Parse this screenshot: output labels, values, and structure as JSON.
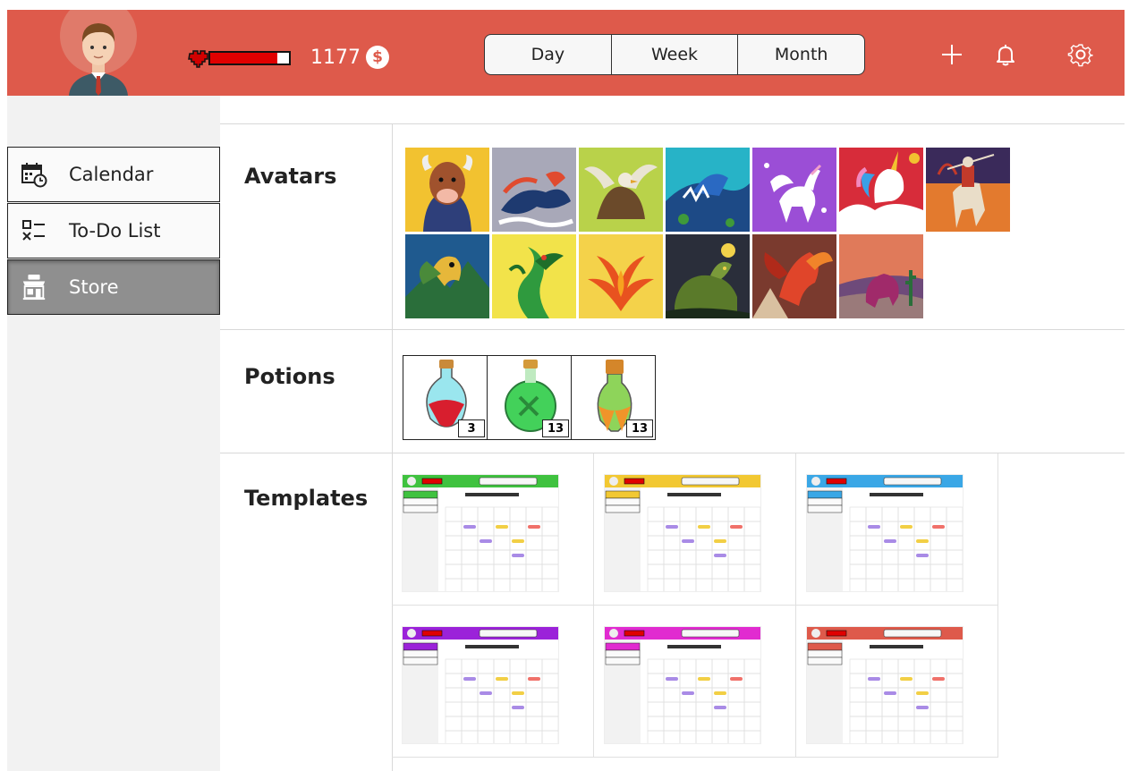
{
  "header": {
    "coins": "1177",
    "coin_symbol": "$",
    "health_fraction": 0.85,
    "views": [
      "Day",
      "Week",
      "Month"
    ],
    "icons": [
      "add-icon",
      "bell-icon",
      "gear-icon"
    ]
  },
  "colors": {
    "header": "#de5a4b",
    "health": "#e00000",
    "sidebar": "#f2f2f2",
    "active_nav": "#8f8f8f"
  },
  "sidebar": {
    "items": [
      {
        "label": "Calendar",
        "icon": "calendar-clock-icon"
      },
      {
        "label": "To-Do List",
        "icon": "checklist-icon"
      },
      {
        "label": "Store",
        "icon": "store-icon"
      }
    ],
    "active": "Store"
  },
  "sections": {
    "avatars": "Avatars",
    "potions": "Potions",
    "templates": "Templates"
  },
  "avatars": [
    {
      "icon": "bull-avatar-icon"
    },
    {
      "icon": "kirin-avatar-icon"
    },
    {
      "icon": "griffin-avatar-icon"
    },
    {
      "icon": "sea-serpent-avatar-icon"
    },
    {
      "icon": "pegasus-avatar-icon"
    },
    {
      "icon": "unicorn-avatar-icon"
    },
    {
      "icon": "centaur-archer-avatar-icon"
    },
    {
      "icon": "harpy-avatar-icon"
    },
    {
      "icon": "green-dragon-avatar-icon"
    },
    {
      "icon": "phoenix-avatar-icon"
    },
    {
      "icon": "chimera-avatar-icon"
    },
    {
      "icon": "red-dragon-avatar-icon"
    },
    {
      "icon": "dinosaur-avatar-icon"
    }
  ],
  "potions": [
    {
      "icon": "red-potion-icon",
      "qty": "3"
    },
    {
      "icon": "green-potion-icon",
      "qty": "13"
    },
    {
      "icon": "orange-potion-icon",
      "qty": "13"
    }
  ],
  "templates": [
    {
      "color": "#3fc23f"
    },
    {
      "color": "#f2c832"
    },
    {
      "color": "#3aa7e6"
    },
    {
      "color": "#9b22d9"
    },
    {
      "color": "#e12bd0"
    },
    {
      "color": "#de5a4b"
    }
  ]
}
